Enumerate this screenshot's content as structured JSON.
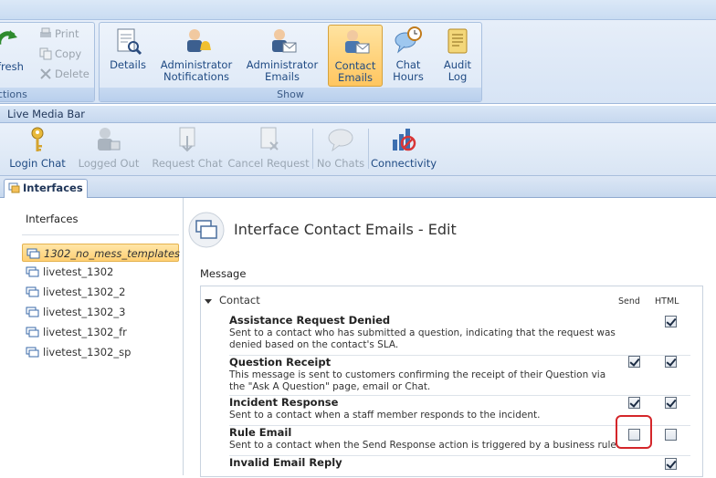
{
  "ribbon": {
    "actions_group": {
      "refresh_label": "fresh",
      "print_label": "Print",
      "copy_label": "Copy",
      "delete_label": "Delete",
      "group_label": "ctions"
    },
    "show_group": {
      "group_label": "Show",
      "buttons": [
        {
          "line1": "Details",
          "line2": ""
        },
        {
          "line1": "Administrator",
          "line2": "Notifications"
        },
        {
          "line1": "Administrator",
          "line2": "Emails"
        },
        {
          "line1": "Contact",
          "line2": "Emails"
        },
        {
          "line1": "Chat",
          "line2": "Hours"
        },
        {
          "line1": "Audit",
          "line2": "Log"
        }
      ]
    }
  },
  "media_bar": {
    "title": "Live Media Bar",
    "buttons": [
      {
        "label": "Login Chat"
      },
      {
        "label": "Logged Out"
      },
      {
        "label": "Request Chat"
      },
      {
        "label": "Cancel Request"
      },
      {
        "label": "No Chats"
      },
      {
        "label": "Connectivity"
      }
    ]
  },
  "tab": {
    "label": "Interfaces"
  },
  "left_panel": {
    "title": "Interfaces",
    "items": [
      "1302_no_mess_templates",
      "livetest_1302",
      "livetest_1302_2",
      "livetest_1302_3",
      "livetest_1302_fr",
      "livetest_1302_sp"
    ]
  },
  "main": {
    "title": "Interface Contact Emails - Edit",
    "section_label": "Message",
    "group_title": "Contact",
    "col_send": "Send",
    "col_html": "HTML",
    "rows": [
      {
        "title": "Assistance Request Denied",
        "desc": "Sent to a contact who has submitted a question, indicating that the request was denied based on the contact's SLA.",
        "send": null,
        "html": true
      },
      {
        "title": "Question Receipt",
        "desc": "This message is sent to customers confirming the receipt of their Question via the \"Ask A Question\" page, email or Chat.",
        "send": true,
        "html": true
      },
      {
        "title": "Incident Response",
        "desc": "Sent to a contact when a staff member responds to the incident.",
        "send": true,
        "html": true
      },
      {
        "title": "Rule Email",
        "desc": "Sent to a contact when the Send Response action is triggered by a business rule.",
        "send": false,
        "html": false
      },
      {
        "title": "Invalid Email Reply",
        "desc": "",
        "send": null,
        "html": true
      }
    ]
  },
  "colors": {
    "accent": "#ffc660",
    "highlight": "#d4262a",
    "ribbon_bg": "#d7e4f5"
  }
}
